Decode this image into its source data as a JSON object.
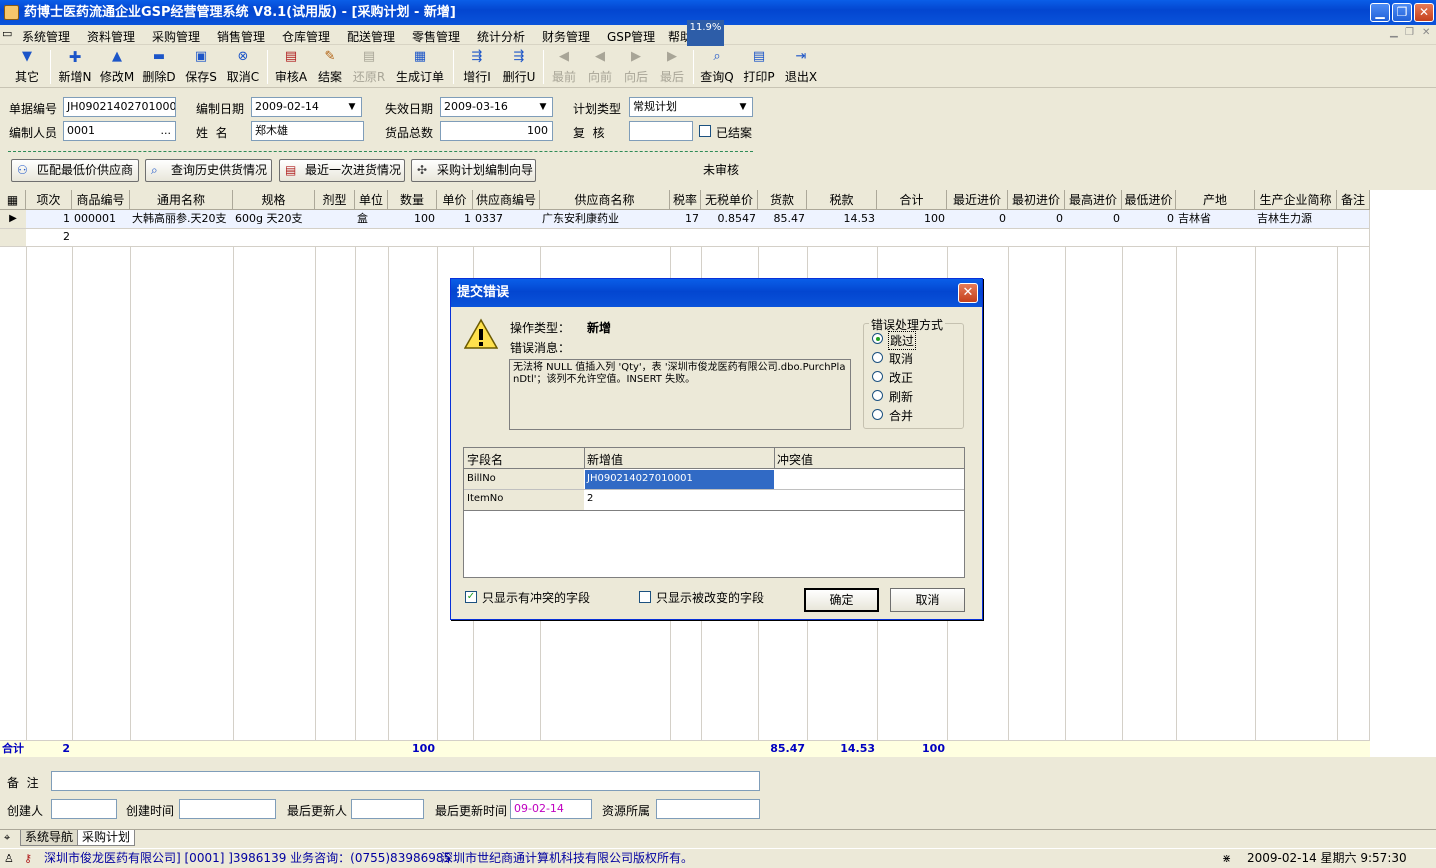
{
  "window": {
    "title": "药博士医药流通企业GSP经营管理系统 V8.1(试用版) - [采购计划 - 新增]",
    "min": "▁",
    "max": "❐",
    "close": "✕",
    "progress_badge": "11.9%"
  },
  "menu": [
    "系统管理",
    "资料管理",
    "采购管理",
    "销售管理",
    "仓库管理",
    "配送管理",
    "零售管理",
    "统计分析",
    "财务管理",
    "GSP管理",
    "帮助"
  ],
  "toolbar": [
    {
      "label": "其它",
      "icon": "down-arrow",
      "enabled": true
    },
    {
      "label": "新增N",
      "icon": "plus",
      "enabled": true
    },
    {
      "label": "修改M",
      "icon": "up-arrow",
      "enabled": true
    },
    {
      "label": "删除D",
      "icon": "minus",
      "enabled": true
    },
    {
      "label": "保存S",
      "icon": "disk",
      "enabled": true
    },
    {
      "label": "取消C",
      "icon": "cancel",
      "enabled": true
    },
    {
      "label": "审核A",
      "icon": "audit",
      "enabled": true
    },
    {
      "label": "结案",
      "icon": "pen",
      "enabled": true
    },
    {
      "label": "还原R",
      "icon": "restore",
      "enabled": false
    },
    {
      "label": "生成订单",
      "icon": "order",
      "enabled": true
    },
    {
      "label": "增行I",
      "icon": "add-row",
      "enabled": true
    },
    {
      "label": "删行U",
      "icon": "del-row",
      "enabled": true
    },
    {
      "label": "最前",
      "icon": "first",
      "enabled": false
    },
    {
      "label": "向前",
      "icon": "prev",
      "enabled": false
    },
    {
      "label": "向后",
      "icon": "next",
      "enabled": false
    },
    {
      "label": "最后",
      "icon": "last",
      "enabled": false
    },
    {
      "label": "查询Q",
      "icon": "search",
      "enabled": true
    },
    {
      "label": "打印P",
      "icon": "printer",
      "enabled": true
    },
    {
      "label": "退出X",
      "icon": "exit",
      "enabled": true
    }
  ],
  "form": {
    "bill_no_label": "单据编号",
    "bill_no": "JH09021402701000l",
    "make_date_label": "编制日期",
    "make_date": "2009-02-14",
    "expire_date_label": "失效日期",
    "expire_date": "2009-03-16",
    "plan_type_label": "计划类型",
    "plan_type": "常规计划",
    "maker_label": "编制人员",
    "maker": "0001",
    "maker_btn": "...",
    "name_label": "姓  名",
    "name": "郑木雄",
    "total_label": "货品总数",
    "total": "100",
    "review_label": "复  核",
    "review": "",
    "closed_label": "已结案",
    "status_text": "未审核"
  },
  "action_buttons": [
    "匹配最低价供应商",
    "查询历史供货情况",
    "最近一次进货情况",
    "采购计划编制向导"
  ],
  "grid": {
    "columns": [
      "项次",
      "商品编号",
      "通用名称",
      "规格",
      "剂型",
      "单位",
      "数量",
      "单价",
      "供应商编号",
      "供应商名称",
      "税率",
      "无税单价",
      "货款",
      "税款",
      "合计",
      "最近进价",
      "最初进价",
      "最高进价",
      "最低进价",
      "产地",
      "生产企业简称",
      "备注"
    ],
    "rows": [
      [
        "1",
        "000001",
        "大韩高丽参.天20支",
        "600g 天20支",
        "",
        "盒",
        "100",
        "1",
        "0337",
        "广东安利康药业",
        "17",
        "0.8547",
        "85.47",
        "14.53",
        "100",
        "0",
        "0",
        "0",
        "0",
        "吉林省",
        "吉林生力源",
        ""
      ],
      [
        "2",
        "",
        "",
        "",
        "",
        "",
        "",
        "",
        "",
        "",
        "",
        "",
        "",
        "",
        "",
        "",
        "",
        "",
        "",
        "",
        "",
        ""
      ]
    ],
    "footer": {
      "label": "合计",
      "count": "2",
      "qty": "100",
      "amount": "85.47",
      "tax": "14.53",
      "sum": "100"
    }
  },
  "bottom": {
    "remark_label": "备  注",
    "remark": "",
    "creator_label": "创建人",
    "creator": "",
    "create_time_label": "创建时间",
    "create_time": "",
    "last_updater_label": "最后更新人",
    "last_updater": "",
    "last_update_time_label": "最后更新时间",
    "last_update_time": "09-02-14",
    "resource_label": "资源所属",
    "resource": ""
  },
  "tabs": [
    "系统导航",
    "采购计划"
  ],
  "statusbar": {
    "company": "深圳市俊龙医药有限公司] [0001] ]3986139 业务咨询：(0755)83986985",
    "copyright": "深圳市世纪商通计算机科技有限公司版权所有。",
    "datetime": "2009-02-14 星期六 9:57:30"
  },
  "dialog": {
    "title": "提交错误",
    "op_type_label": "操作类型：",
    "op_type": "新增",
    "err_msg_label": "错误消息：",
    "err_msg": "无法将 NULL 值插入列 'Qty'，表 '深圳市俊龙医药有限公司.dbo.PurchPlanDtl'；该列不允许空值。INSERT 失败。",
    "handling_label": "错误处理方式",
    "options": [
      "跳过",
      "取消",
      "改正",
      "刷新",
      "合并"
    ],
    "table_cols": [
      "字段名",
      "新增值",
      "冲突值"
    ],
    "table_rows": [
      [
        "BillNo",
        "JH090214027010001",
        ""
      ],
      [
        "ItemNo",
        "2",
        ""
      ]
    ],
    "chk_conflict": "只显示有冲突的字段",
    "chk_changed": "只显示被改变的字段",
    "ok": "确定",
    "cancel": "取消"
  }
}
